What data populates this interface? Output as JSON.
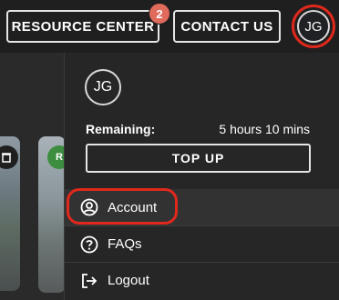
{
  "header": {
    "resource_center_label": "RESOURCE CENTER",
    "resource_center_badge": "2",
    "contact_us_label": "CONTACT US",
    "user_initials": "JG"
  },
  "background": {
    "thumb_b_label": "R"
  },
  "menu": {
    "user_initials": "JG",
    "remaining_label": "Remaining:",
    "remaining_value": "5 hours 10 mins",
    "top_up_label": "TOP UP",
    "items": [
      {
        "label": "Account",
        "icon": "account-icon"
      },
      {
        "label": "FAQs",
        "icon": "help-icon"
      },
      {
        "label": "Logout",
        "icon": "logout-icon"
      }
    ]
  },
  "colors": {
    "highlight_ring": "#e0281c",
    "badge": "#e06a5c",
    "panel": "#262626",
    "header": "#1f1f1f"
  }
}
